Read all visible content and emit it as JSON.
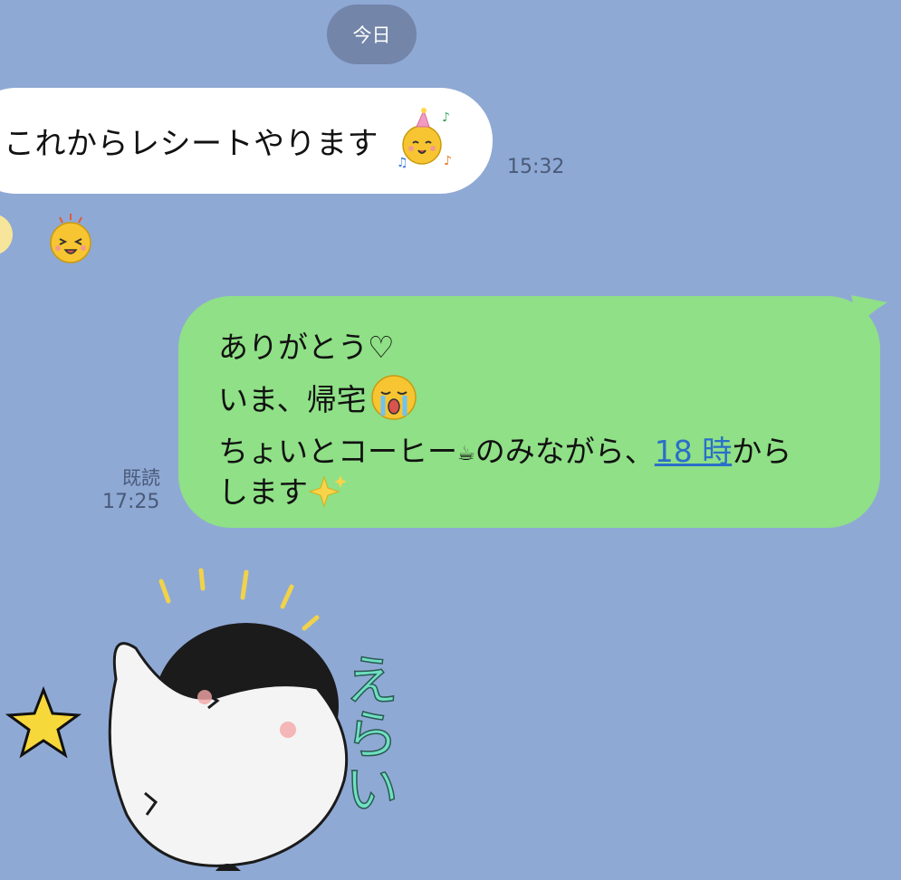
{
  "date_divider": "今日",
  "incoming": {
    "text": "これからレシートやります",
    "emoji": "party-hat-smiley-emoji",
    "time": "15:32",
    "reaction_emoji": "excited-smiley-emoji"
  },
  "outgoing": {
    "line1": "ありがとう♡",
    "line2_text": "いま、帰宅",
    "line2_emoji": "crying-smiley-emoji",
    "line3_before": "ちょいとコーヒー",
    "line3_cup": "☕",
    "line3_mid": "のみながら、",
    "line3_link": "18 時",
    "line3_after": "から",
    "line4_text": "します",
    "line4_emoji": "sparkles-emoji",
    "read_label": "既読",
    "time": "17:25"
  },
  "sticker": {
    "name": "penguin-sticker",
    "caption": "えらい"
  },
  "colors": {
    "background": "#8fa9d5",
    "incoming_bubble": "#ffffff",
    "outgoing_bubble": "#8fe086",
    "link": "#2a6fc9"
  }
}
